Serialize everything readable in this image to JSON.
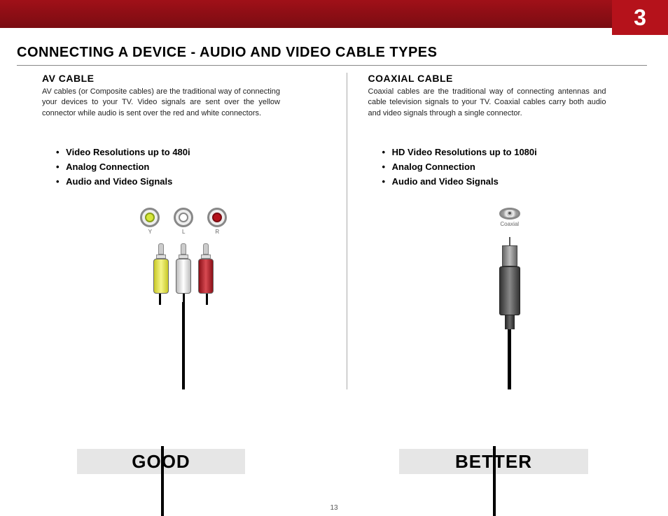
{
  "chapter_number": "3",
  "main_title": "CONNECTING A DEVICE - AUDIO AND VIDEO CABLE TYPES",
  "page_number": "13",
  "left": {
    "heading": "AV CABLE",
    "description": "AV cables (or Composite cables) are the traditional way of connecting your devices to your TV. Video signals are sent over the yellow connector while audio is sent over the red and white connectors.",
    "bullets": [
      "Video Resolutions up to 480i",
      "Analog Connection",
      "Audio and Video Signals"
    ],
    "jack_labels": {
      "y": "Y",
      "l": "L",
      "r": "R"
    },
    "rating": "GOOD"
  },
  "right": {
    "heading": "COAXIAL CABLE",
    "description": "Coaxial cables are the traditional way of connecting antennas and cable television signals to your TV. Coaxial cables carry both audio and video signals through a single connector.",
    "bullets": [
      "HD Video Resolutions up to 1080i",
      "Analog Connection",
      "Audio and Video Signals"
    ],
    "jack_label": "Coaxial",
    "rating": "BETTER"
  }
}
